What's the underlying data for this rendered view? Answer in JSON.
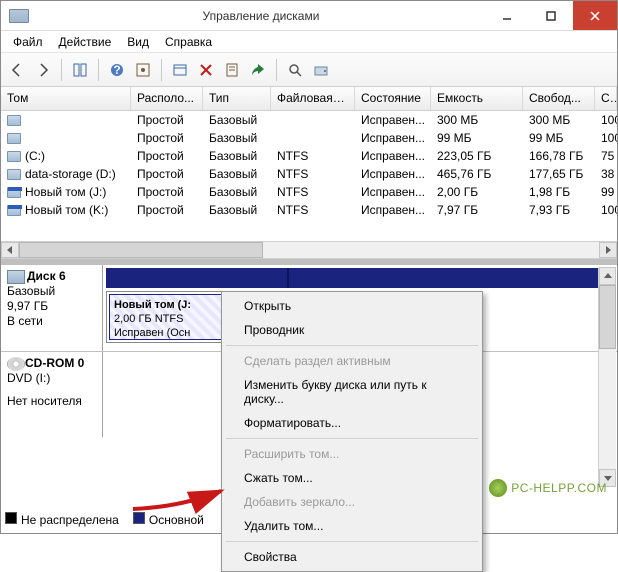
{
  "window": {
    "title": "Управление дисками"
  },
  "menubar": {
    "file": "Файл",
    "action": "Действие",
    "view": "Вид",
    "help": "Справка"
  },
  "columns": {
    "tom": "Том",
    "location": "Располо...",
    "type": "Тип",
    "fs": "Файловая с...",
    "state": "Состояние",
    "capacity": "Емкость",
    "free": "Свобод...",
    "pct": "Св"
  },
  "volumes": [
    {
      "name": "",
      "loc": "Простой",
      "type": "Базовый",
      "fs": "",
      "state": "Исправен...",
      "cap": "300 МБ",
      "free": "300 МБ",
      "pct": "100",
      "iconBlue": false
    },
    {
      "name": "",
      "loc": "Простой",
      "type": "Базовый",
      "fs": "",
      "state": "Исправен...",
      "cap": "99 МБ",
      "free": "99 МБ",
      "pct": "100",
      "iconBlue": false
    },
    {
      "name": "(C:)",
      "loc": "Простой",
      "type": "Базовый",
      "fs": "NTFS",
      "state": "Исправен...",
      "cap": "223,05 ГБ",
      "free": "166,78 ГБ",
      "pct": "75",
      "iconBlue": false
    },
    {
      "name": "data-storage (D:)",
      "loc": "Простой",
      "type": "Базовый",
      "fs": "NTFS",
      "state": "Исправен...",
      "cap": "465,76 ГБ",
      "free": "177,65 ГБ",
      "pct": "38",
      "iconBlue": false
    },
    {
      "name": "Новый том (J:)",
      "loc": "Простой",
      "type": "Базовый",
      "fs": "NTFS",
      "state": "Исправен...",
      "cap": "2,00 ГБ",
      "free": "1,98 ГБ",
      "pct": "99",
      "iconBlue": true
    },
    {
      "name": "Новый том (K:)",
      "loc": "Простой",
      "type": "Базовый",
      "fs": "NTFS",
      "state": "Исправен...",
      "cap": "7,97 ГБ",
      "free": "7,93 ГБ",
      "pct": "100",
      "iconBlue": true
    }
  ],
  "disk6": {
    "label": "Диск 6",
    "type": "Базовый",
    "size": "9,97 ГБ",
    "status": "В сети",
    "partition": {
      "name": "Новый том  (J:",
      "size": "2,00 ГБ NTFS",
      "state": "Исправен (Осн"
    }
  },
  "cdrom": {
    "label": "CD-ROM 0",
    "type": "DVD (I:)",
    "status": "Нет носителя"
  },
  "contextMenu": {
    "open": "Открыть",
    "explorer": "Проводник",
    "makeActive": "Сделать раздел активным",
    "changeLetter": "Изменить букву диска или путь к диску...",
    "format": "Форматировать...",
    "extend": "Расширить том...",
    "shrink": "Сжать том...",
    "addMirror": "Добавить зеркало...",
    "delete": "Удалить том...",
    "properties": "Свойства"
  },
  "legend": {
    "unallocated": "Не распределена",
    "primary": "Основной"
  },
  "watermark": "PC-HELPP.COM"
}
